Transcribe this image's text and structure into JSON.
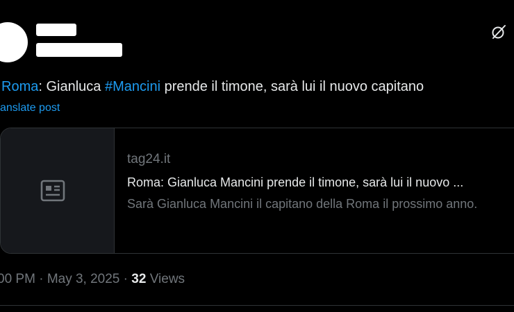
{
  "tweet": {
    "text_parts": {
      "link1": "Roma",
      "text1": ": Gianluca ",
      "hashtag": "#Mancini",
      "text2": " prende il timone, sarà lui il nuovo capitano"
    },
    "translate_label": "anslate post"
  },
  "card": {
    "domain": "tag24.it",
    "title": "Roma: Gianluca Mancini prende il timone, sarà lui il nuovo ...",
    "description": "Sarà Gianluca Mancini il capitano della Roma il prossimo anno.",
    "thumbnail_icon": "article-icon"
  },
  "meta": {
    "time": "00 PM",
    "separator1": " · ",
    "date": "May 3, 2025",
    "separator2": " · ",
    "views_count": "32",
    "views_label": " Views"
  },
  "icons": {
    "header_action": "grok-icon"
  },
  "colors": {
    "background": "#000000",
    "text": "#e7e9ea",
    "muted": "#71767b",
    "link": "#1d9bf0",
    "border": "#2f3336"
  }
}
